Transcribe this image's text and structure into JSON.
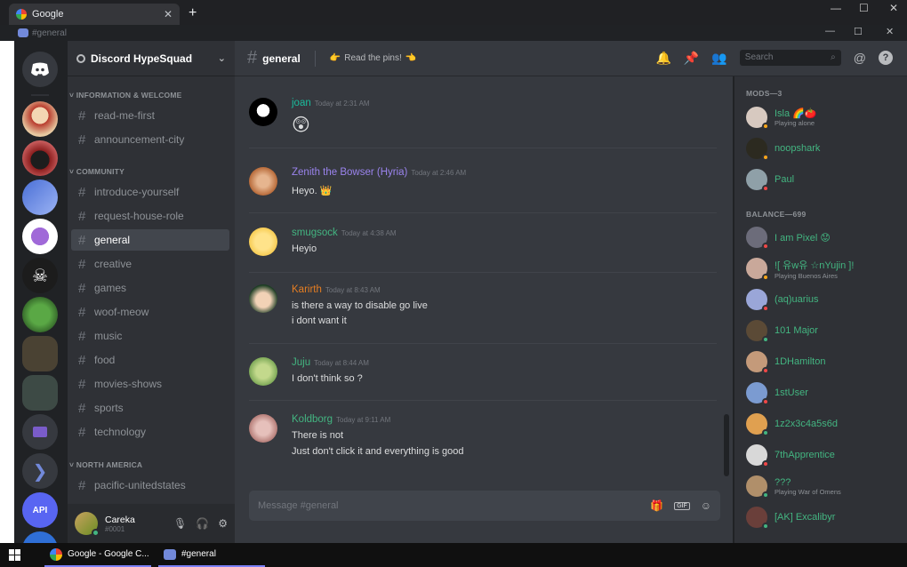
{
  "browser": {
    "tab_title": "Google",
    "new_tab": "+",
    "win_min": "—",
    "win_max": "☐",
    "win_close": "✕"
  },
  "discord_window": {
    "title": "#general",
    "min": "—",
    "max": "☐",
    "close": "✕"
  },
  "server": {
    "name": "Discord HypeSquad",
    "categories": [
      {
        "label": "INFORMATION & WELCOME"
      },
      {
        "label": "COMMUNITY"
      },
      {
        "label": "NORTH AMERICA"
      }
    ],
    "channels": [
      {
        "label": "read-me-first"
      },
      {
        "label": "announcement-city"
      },
      {
        "label": "introduce-yourself"
      },
      {
        "label": "request-house-role"
      },
      {
        "label": "general"
      },
      {
        "label": "creative"
      },
      {
        "label": "games"
      },
      {
        "label": "woof-meow"
      },
      {
        "label": "music"
      },
      {
        "label": "food"
      },
      {
        "label": "movies-shows"
      },
      {
        "label": "sports"
      },
      {
        "label": "technology"
      },
      {
        "label": "pacific-unitedstates"
      }
    ]
  },
  "user": {
    "name": "Careka",
    "tag": "#0001"
  },
  "chat": {
    "channel": "general",
    "topic": "Read the pins!",
    "search_placeholder": "Search",
    "composer_placeholder": "Message #general",
    "messages": [
      {
        "author": "joan",
        "time": "Today at 2:31 AM",
        "lines": [
          ""
        ],
        "color": "#1abc9c"
      },
      {
        "author": "Zenith the Bowser (Hyria)",
        "time": "Today at 2:46 AM",
        "lines": [
          "Heyo."
        ],
        "color": "#9b84ee"
      },
      {
        "author": "smugsock",
        "time": "Today at 4:38 AM",
        "lines": [
          "Heyio"
        ],
        "color": "#43b581"
      },
      {
        "author": "Karirth",
        "time": "Today at 8:43 AM",
        "lines": [
          "is there a way to disable go live",
          "i dont want it"
        ],
        "color": "#e67e22"
      },
      {
        "author": "Juju",
        "time": "Today at 8:44 AM",
        "lines": [
          "I don't think so ?"
        ],
        "color": "#43b581"
      },
      {
        "author": "Koldborg",
        "time": "Today at 9:11 AM",
        "lines": [
          "There is not",
          "Just don't click it and everything is good"
        ],
        "color": "#43b581"
      }
    ]
  },
  "members": {
    "mods_label": "MODS—3",
    "balance_label": "BALANCE—699",
    "list": [
      {
        "name": "Isla",
        "activity": "Playing alone",
        "status": "#faa61a"
      },
      {
        "name": "noopshark",
        "activity": "",
        "status": "#faa61a"
      },
      {
        "name": "Paul",
        "activity": "",
        "status": "#f04747"
      },
      {
        "name": "I am Pixel",
        "activity": "",
        "status": "#f04747"
      },
      {
        "name": "![ 유w유 ☆nYujin ]!",
        "activity": "Playing Buenos Aires",
        "status": "#faa61a"
      },
      {
        "name": "(aq)uarius",
        "activity": "",
        "status": "#f04747"
      },
      {
        "name": "101 Major",
        "activity": "",
        "status": "#43b581"
      },
      {
        "name": "1DHamilton",
        "activity": "",
        "status": "#f04747"
      },
      {
        "name": "1stUser",
        "activity": "",
        "status": "#f04747"
      },
      {
        "name": "1z2x3c4a5s6d",
        "activity": "",
        "status": "#43b581"
      },
      {
        "name": "7thApprentice",
        "activity": "",
        "status": "#f04747"
      },
      {
        "name": "???",
        "activity": "Playing War of Omens",
        "status": "#43b581"
      },
      {
        "name": "[AK] Excalibyr",
        "activity": "",
        "status": "#43b581"
      }
    ]
  },
  "taskbar": {
    "chrome_item": "Google - Google C...",
    "discord_item": "#general"
  }
}
